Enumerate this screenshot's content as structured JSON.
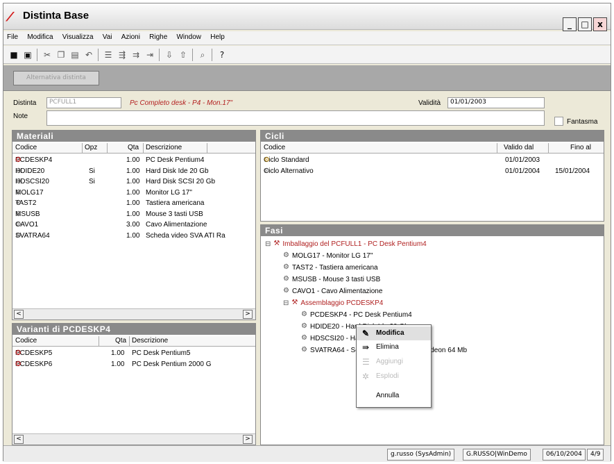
{
  "window": {
    "title": "Distinta Base",
    "minimize": "_",
    "maximize": "□",
    "close": "x"
  },
  "menu": [
    "File",
    "Modifica",
    "Visualizza",
    "Vai",
    "Azioni",
    "Righe",
    "Window",
    "Help"
  ],
  "toolbar_icons": [
    "save-icon",
    "window-icon",
    "cut-icon",
    "copy-icon",
    "paste-icon",
    "undo-icon",
    "add-row-icon",
    "insert-row-icon",
    "append-row-icon",
    "indent-icon",
    "move-down-icon",
    "move-up-icon",
    "preview-icon",
    "help-icon"
  ],
  "strip": {
    "button_label": "Alternativa distinta"
  },
  "header": {
    "distinta_label": "Distinta",
    "distinta_value": "PCFULL1",
    "descrizione": "Pc Completo desk - P4 - Mon.17\"",
    "validita_label": "Validità",
    "validita_value": "01/01/2003",
    "note_label": "Note",
    "note_value": "",
    "fantasma_label": "Fantasma"
  },
  "materiali": {
    "title": "Materiali",
    "columns": {
      "codice": "Codice",
      "opz": "Opz",
      "qta": "Qta",
      "descrizione": "Descrizione"
    },
    "rows": [
      {
        "codice": "PCDESKP4",
        "opz": "",
        "qta": "1.00",
        "descrizione": "PC Desk Pentium4",
        "icon": "assembly-icon"
      },
      {
        "codice": "HDIDE20",
        "opz": "Si",
        "qta": "1.00",
        "descrizione": "Hard Disk Ide 20 Gb",
        "icon": "part-icon"
      },
      {
        "codice": "HDSCSI20",
        "opz": "Si",
        "qta": "1.00",
        "descrizione": "Hard Disk SCSI 20 Gb",
        "icon": "part-icon"
      },
      {
        "codice": "MOLG17",
        "opz": "",
        "qta": "1.00",
        "descrizione": "Monitor LG 17\"",
        "icon": "part-icon"
      },
      {
        "codice": "TAST2",
        "opz": "",
        "qta": "1.00",
        "descrizione": "Tastiera americana",
        "icon": "part-icon"
      },
      {
        "codice": "MSUSB",
        "opz": "",
        "qta": "1.00",
        "descrizione": "Mouse 3 tasti USB",
        "icon": "part-icon"
      },
      {
        "codice": "CAVO1",
        "opz": "",
        "qta": "3.00",
        "descrizione": "Cavo Alimentazione",
        "icon": "part-icon"
      },
      {
        "codice": "SVATRA64",
        "opz": "",
        "qta": "1.00",
        "descrizione": "Scheda video SVA ATI Ra",
        "icon": "part-icon"
      }
    ]
  },
  "varianti": {
    "title": "Varianti di PCDESKP4",
    "columns": {
      "codice": "Codice",
      "qta": "Qta",
      "descrizione": "Descrizione"
    },
    "rows": [
      {
        "codice": "PCDESKP5",
        "qta": "1.00",
        "descrizione": "PC Desk Pentium5"
      },
      {
        "codice": "PCDESKP6",
        "qta": "1.00",
        "descrizione": "PC Desk Pentium 2000 G"
      }
    ]
  },
  "cicli": {
    "title": "Cicli",
    "columns": {
      "codice": "Codice",
      "valido_dal": "Valido dal",
      "fino_al": "Fino al"
    },
    "rows": [
      {
        "codice": "Ciclo Standard",
        "valido_dal": "01/01/2003",
        "fino_al": ""
      },
      {
        "codice": "Ciclo Alternativo",
        "valido_dal": "01/01/2004",
        "fino_al": "15/01/2004"
      }
    ]
  },
  "fasi": {
    "title": "Fasi",
    "nodes": [
      {
        "text": "Imballaggio del PCFULL1 - PC Desk Pentium4",
        "level": 0,
        "red": true,
        "expander": "⊟"
      },
      {
        "text": "MOLG17 - Monitor LG 17\"",
        "level": 1,
        "red": false
      },
      {
        "text": "TAST2 - Tastiera americana",
        "level": 1,
        "red": false
      },
      {
        "text": "MSUSB - Mouse 3 tasti USB",
        "level": 1,
        "red": false
      },
      {
        "text": "CAVO1 - Cavo Alimentazione",
        "level": 1,
        "red": false
      },
      {
        "text": "Assemblaggio PCDESKP4",
        "level": 1,
        "red": true,
        "expander": "⊟"
      },
      {
        "text": "PCDESKP4 - PC Desk Pentium4",
        "level": 2,
        "red": false
      },
      {
        "text": "HDIDE20 - Hard Disk Ide 20 Gb",
        "level": 2,
        "red": false
      },
      {
        "text": "HDSCSI20 - Hard Disk SCSI 20 Gb",
        "level": 2,
        "red": false
      },
      {
        "text": "SVATRA64 - Scheda video SVA ATI Radeon 64 Mb",
        "level": 2,
        "red": false
      }
    ]
  },
  "context_menu": {
    "items": [
      {
        "label": "Modifica",
        "state": "highlighted",
        "icon": "pencil-icon"
      },
      {
        "label": "Elimina",
        "state": "normal",
        "icon": "delete-icon"
      },
      {
        "label": "Aggiungi",
        "state": "disabled",
        "icon": "add-icon"
      },
      {
        "label": "Esplodi",
        "state": "disabled",
        "icon": "explode-icon"
      },
      {
        "label": "Annulla",
        "state": "normal",
        "icon": ""
      }
    ]
  },
  "status": {
    "user": "g.russo (SysAdmin)",
    "company": "G.RUSSO|WinDemo",
    "date": "06/10/2004",
    "page": "4/9"
  },
  "colors": {
    "panel_header": "#8a8a8a",
    "accent_red": "#b02020"
  }
}
